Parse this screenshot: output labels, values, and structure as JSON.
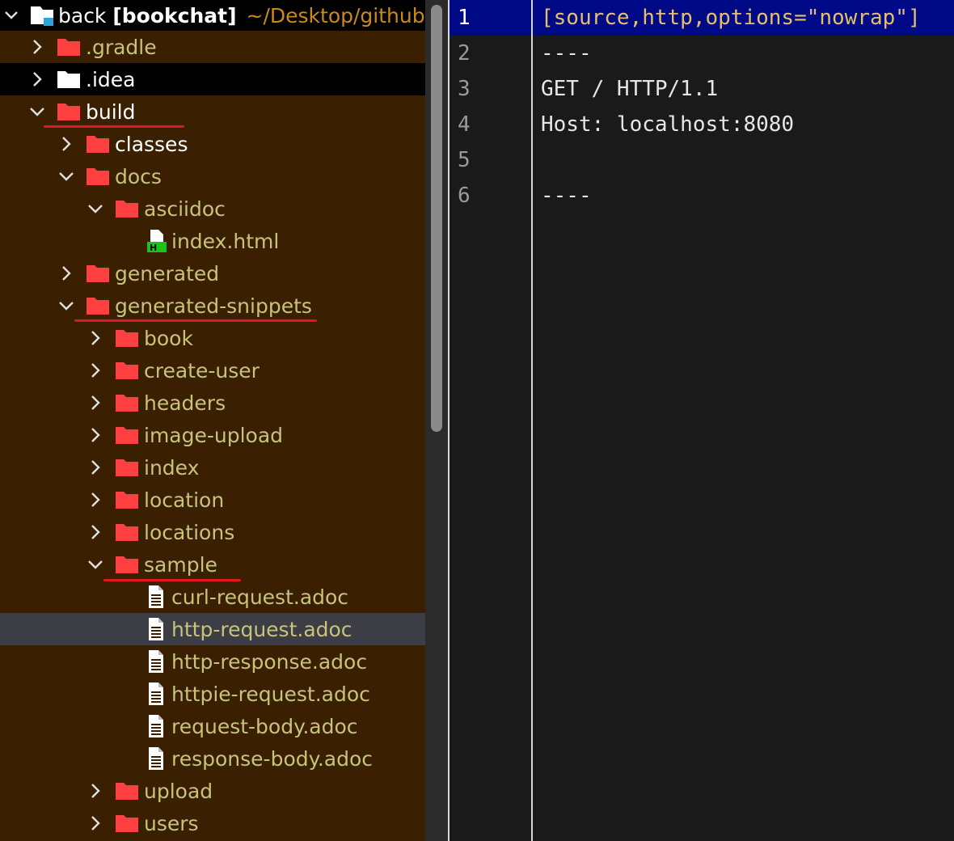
{
  "tree": {
    "header": {
      "prefix": "back ",
      "project": "[bookchat]",
      "path": "~/Desktop/github/b"
    },
    "items": [
      {
        "label": ".gradle",
        "chevron": "right",
        "icon": "folder"
      },
      {
        "label": ".idea",
        "chevron": "right",
        "icon": "folder-white"
      },
      {
        "label": "build",
        "chevron": "down",
        "icon": "folder"
      },
      {
        "label": "classes",
        "chevron": "right",
        "icon": "folder"
      },
      {
        "label": "docs",
        "chevron": "down",
        "icon": "folder"
      },
      {
        "label": "asciidoc",
        "chevron": "down",
        "icon": "folder"
      },
      {
        "label": "index.html",
        "chevron": "none",
        "icon": "html-file"
      },
      {
        "label": "generated",
        "chevron": "right",
        "icon": "folder"
      },
      {
        "label": "generated-snippets",
        "chevron": "down",
        "icon": "folder"
      },
      {
        "label": "book",
        "chevron": "right",
        "icon": "folder"
      },
      {
        "label": "create-user",
        "chevron": "right",
        "icon": "folder"
      },
      {
        "label": "headers",
        "chevron": "right",
        "icon": "folder"
      },
      {
        "label": "image-upload",
        "chevron": "right",
        "icon": "folder"
      },
      {
        "label": "index",
        "chevron": "right",
        "icon": "folder"
      },
      {
        "label": "location",
        "chevron": "right",
        "icon": "folder"
      },
      {
        "label": "locations",
        "chevron": "right",
        "icon": "folder"
      },
      {
        "label": "sample",
        "chevron": "down",
        "icon": "folder"
      },
      {
        "label": "curl-request.adoc",
        "chevron": "none",
        "icon": "file"
      },
      {
        "label": "http-request.adoc",
        "chevron": "none",
        "icon": "file"
      },
      {
        "label": "http-response.adoc",
        "chevron": "none",
        "icon": "file"
      },
      {
        "label": "httpie-request.adoc",
        "chevron": "none",
        "icon": "file"
      },
      {
        "label": "request-body.adoc",
        "chevron": "none",
        "icon": "file"
      },
      {
        "label": "response-body.adoc",
        "chevron": "none",
        "icon": "file"
      },
      {
        "label": "upload",
        "chevron": "right",
        "icon": "folder"
      },
      {
        "label": "users",
        "chevron": "right",
        "icon": "folder"
      }
    ]
  },
  "editor": {
    "lines": [
      {
        "num": "1",
        "text": "[source,http,options=\"nowrap\"]"
      },
      {
        "num": "2",
        "text": "----"
      },
      {
        "num": "3",
        "text": "GET / HTTP/1.1"
      },
      {
        "num": "4",
        "text": "Host: localhost:8080"
      },
      {
        "num": "5",
        "text": ""
      },
      {
        "num": "6",
        "text": "----"
      }
    ]
  },
  "colors": {
    "tree_bg": "#3a1f01",
    "folder": "#ff4040",
    "label": "#c5c47a",
    "selection": "#3d3d45",
    "annotation": "#e01818",
    "current_line": "#000a87",
    "current_line_text": "#e3c06a"
  }
}
